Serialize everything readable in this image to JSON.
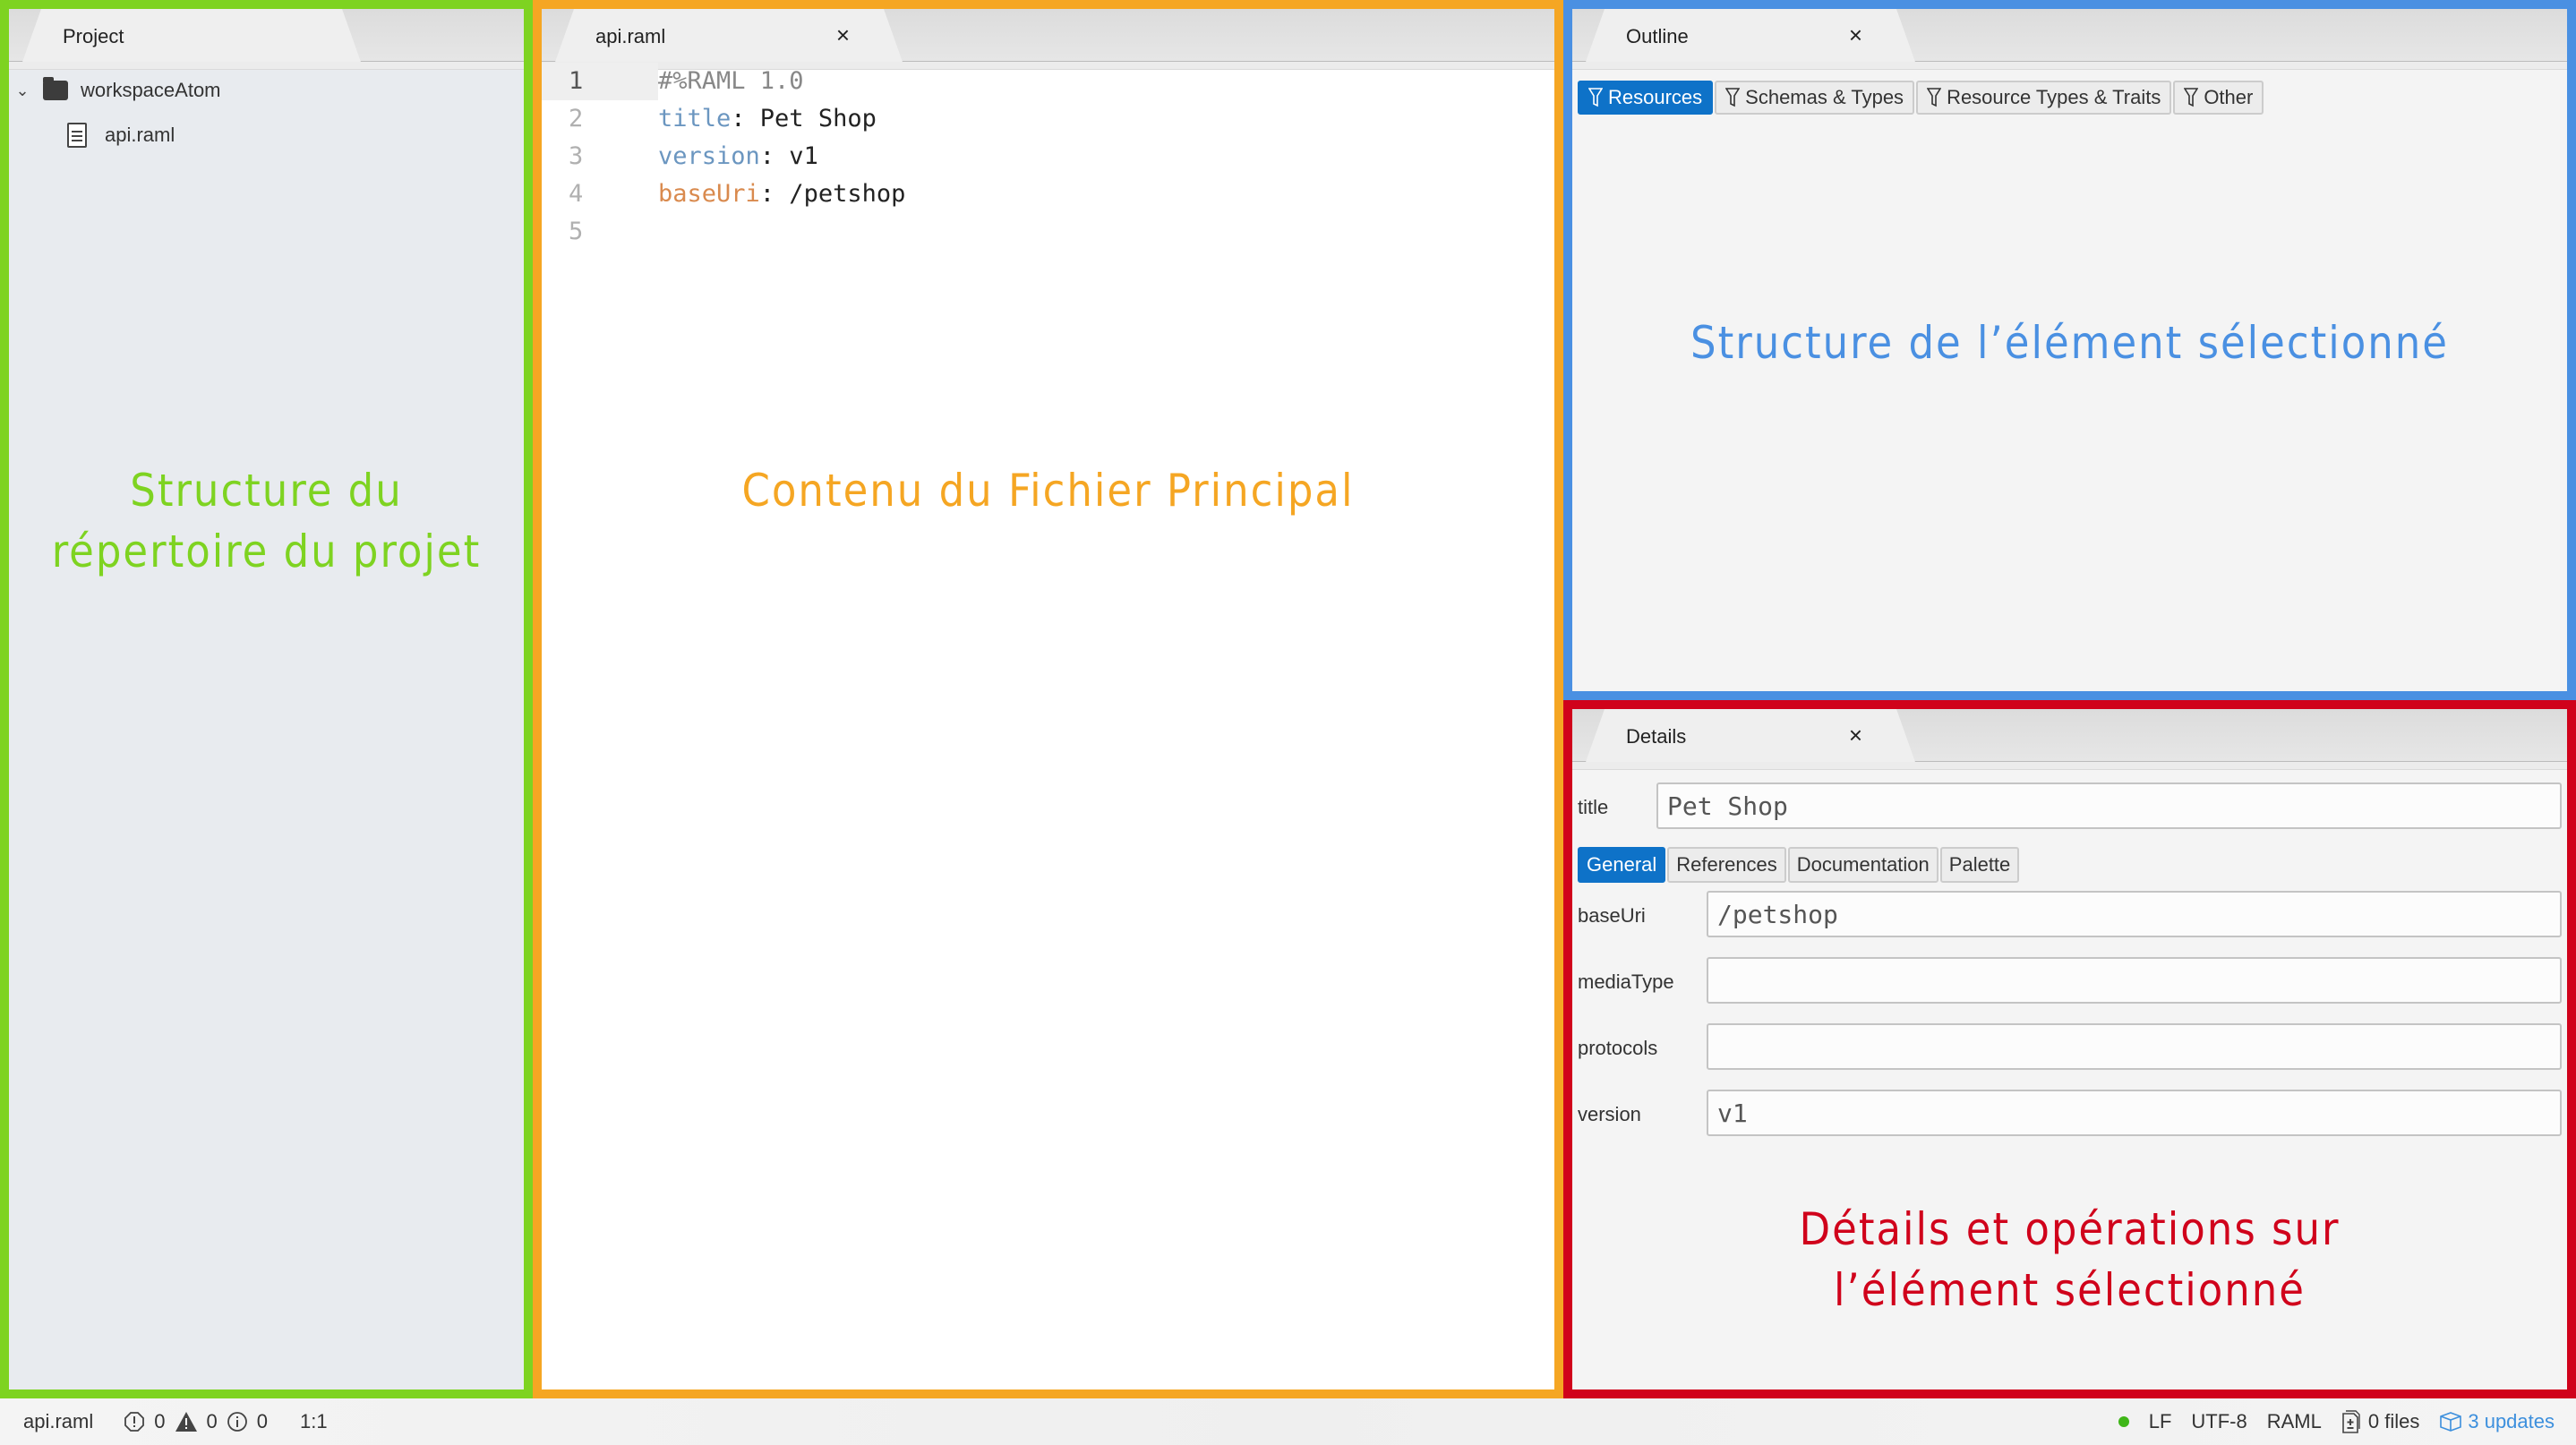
{
  "project": {
    "tab_label": "Project",
    "tree": {
      "root": {
        "label": "workspaceAtom",
        "expanded": true
      },
      "children": [
        {
          "label": "api.raml"
        }
      ]
    }
  },
  "editor": {
    "tab_label": "api.raml",
    "close_glyph": "×",
    "lines": [
      {
        "num": "1",
        "parts": [
          {
            "cls": "t-comment",
            "text": "#%RAML 1.0"
          }
        ]
      },
      {
        "num": "2",
        "parts": [
          {
            "cls": "t-key-blue",
            "text": "title"
          },
          {
            "cls": "t-val",
            "text": ": Pet Shop"
          }
        ]
      },
      {
        "num": "3",
        "parts": [
          {
            "cls": "t-key-blue",
            "text": "version"
          },
          {
            "cls": "t-val",
            "text": ": v1"
          }
        ]
      },
      {
        "num": "4",
        "parts": [
          {
            "cls": "t-key-orange",
            "text": "baseUri"
          },
          {
            "cls": "t-val",
            "text": ": /petshop"
          }
        ]
      },
      {
        "num": "5",
        "parts": []
      }
    ]
  },
  "outline": {
    "tab_label": "Outline",
    "close_glyph": "×",
    "filters": [
      {
        "label": "Resources",
        "active": true
      },
      {
        "label": "Schemas & Types",
        "active": false
      },
      {
        "label": "Resource Types & Traits",
        "active": false
      },
      {
        "label": "Other",
        "active": false
      }
    ]
  },
  "details": {
    "tab_label": "Details",
    "close_glyph": "×",
    "title_label": "title",
    "title_value": "Pet Shop",
    "subtabs": [
      {
        "label": "General",
        "active": true
      },
      {
        "label": "References",
        "active": false
      },
      {
        "label": "Documentation",
        "active": false
      },
      {
        "label": "Palette",
        "active": false
      }
    ],
    "fields": [
      {
        "label": "baseUri",
        "value": "/petshop"
      },
      {
        "label": "mediaType",
        "value": ""
      },
      {
        "label": "protocols",
        "value": ""
      },
      {
        "label": "version",
        "value": "v1"
      }
    ]
  },
  "annotations": {
    "project": "Structure du\nrépertoire du projet",
    "editor": "Contenu du Fichier Principal",
    "outline": "Structure de l’élément sélectionné",
    "details": "Détails et opérations sur\nl’élément sélectionné",
    "colors": {
      "project": "#7ed321",
      "editor": "#f5a623",
      "outline": "#4a90e2",
      "details": "#d0021b"
    }
  },
  "statusbar": {
    "file": "api.raml",
    "errors": "0",
    "warnings": "0",
    "infos": "0",
    "cursor": "1:1",
    "line_ending": "LF",
    "encoding": "UTF-8",
    "grammar": "RAML",
    "files": "0 files",
    "updates": "3 updates"
  }
}
